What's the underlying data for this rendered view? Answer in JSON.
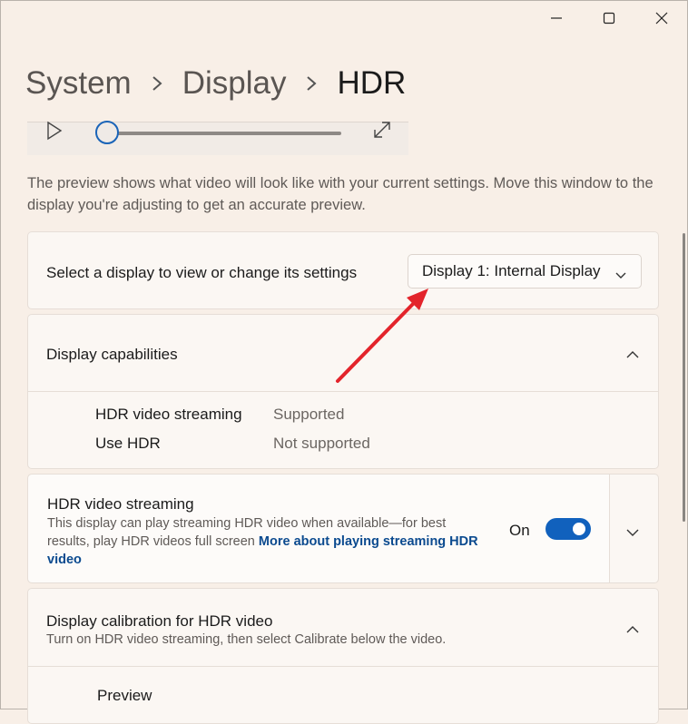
{
  "window": {
    "minimize_icon": "minimize-icon",
    "maximize_icon": "maximize-icon",
    "close_icon": "close-icon"
  },
  "breadcrumb": {
    "items": [
      "System",
      "Display",
      "HDR"
    ]
  },
  "preview_note": "The preview shows what video will look like with your current settings. Move this window to the display you're adjusting to get an accurate preview.",
  "display_select": {
    "label": "Select a display to view or change its settings",
    "value": "Display 1: Internal Display"
  },
  "capabilities": {
    "title": "Display capabilities",
    "rows": [
      {
        "key": "HDR video streaming",
        "value": "Supported"
      },
      {
        "key": "Use HDR",
        "value": "Not supported"
      }
    ]
  },
  "hdr_streaming": {
    "title": "HDR video streaming",
    "description": "This display can play streaming HDR video when available—for best results, play HDR videos full screen ",
    "link": "More about playing streaming HDR video",
    "toggle_state_text": "On",
    "toggle_on": true
  },
  "calibration": {
    "title": "Display calibration for HDR video",
    "description": "Turn on HDR video streaming, then select Calibrate below the video.",
    "preview_label": "Preview"
  },
  "colors": {
    "accent": "#1161bd",
    "annotation_arrow": "#e3242b",
    "link": "#0b4a8f"
  }
}
